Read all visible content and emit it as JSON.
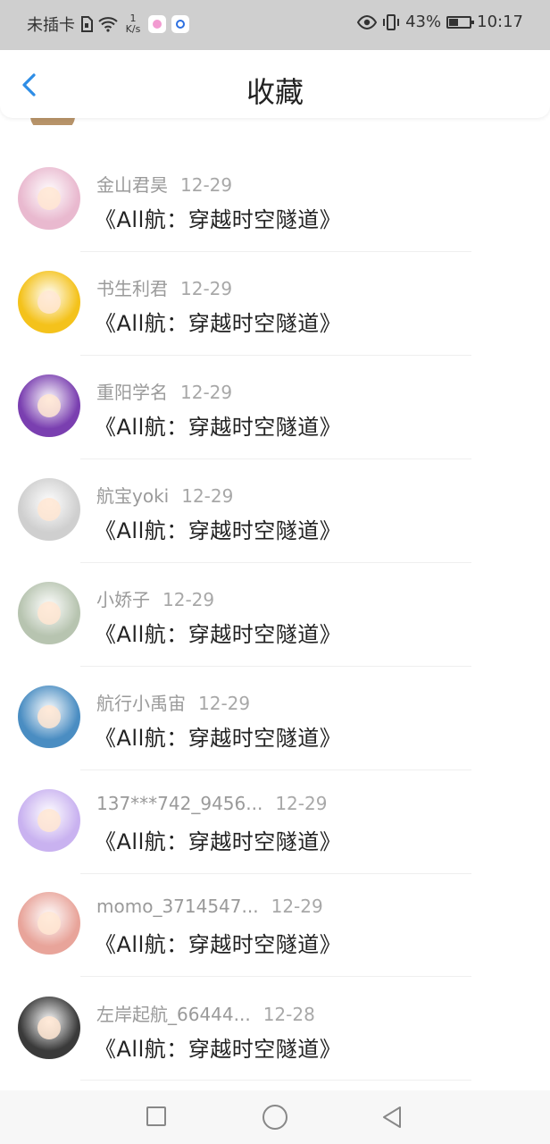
{
  "status_bar": {
    "carrier": "未插卡",
    "speed_value": "1",
    "speed_unit": "K/s",
    "battery": "43%",
    "time": "10:17",
    "icons": [
      "sim-icon",
      "wifi-icon",
      "app-icon-pink",
      "app-icon-blue",
      "eye-icon",
      "vibrate-icon",
      "battery-icon"
    ]
  },
  "header": {
    "title": "收藏",
    "back_icon": "chevron-left-icon"
  },
  "items": [
    {
      "name": "金山君昊",
      "date": "12-29",
      "text": "《All航：穿越时空隧道》",
      "avatar_color": "#e9b9cf"
    },
    {
      "name": "书生利君",
      "date": "12-29",
      "text": "《All航：穿越时空隧道》",
      "avatar_color": "#f4c21b"
    },
    {
      "name": "重阳学名",
      "date": "12-29",
      "text": "《All航：穿越时空隧道》",
      "avatar_color": "#7a3fb0"
    },
    {
      "name": "航宝yoki",
      "date": "12-29",
      "text": "《All航：穿越时空隧道》",
      "avatar_color": "#cfcfcf"
    },
    {
      "name": "小娇子",
      "date": "12-29",
      "text": "《All航：穿越时空隧道》",
      "avatar_color": "#b7c4b0"
    },
    {
      "name": "航行小禹宙",
      "date": "12-29",
      "text": "《All航：穿越时空隧道》",
      "avatar_color": "#4a8dc2"
    },
    {
      "name": "137***742_9456...",
      "date": "12-29",
      "text": "《All航：穿越时空隧道》",
      "avatar_color": "#c9b2f0"
    },
    {
      "name": "momo_3714547...",
      "date": "12-29",
      "text": "《All航：穿越时空隧道》",
      "avatar_color": "#e8a49a"
    },
    {
      "name": "左岸起航_66444...",
      "date": "12-28",
      "text": "《All航：穿越时空隧道》",
      "avatar_color": "#3a3a3a"
    }
  ],
  "nav_bar": {
    "icons": [
      "recent-apps-icon",
      "home-icon",
      "back-icon"
    ]
  }
}
